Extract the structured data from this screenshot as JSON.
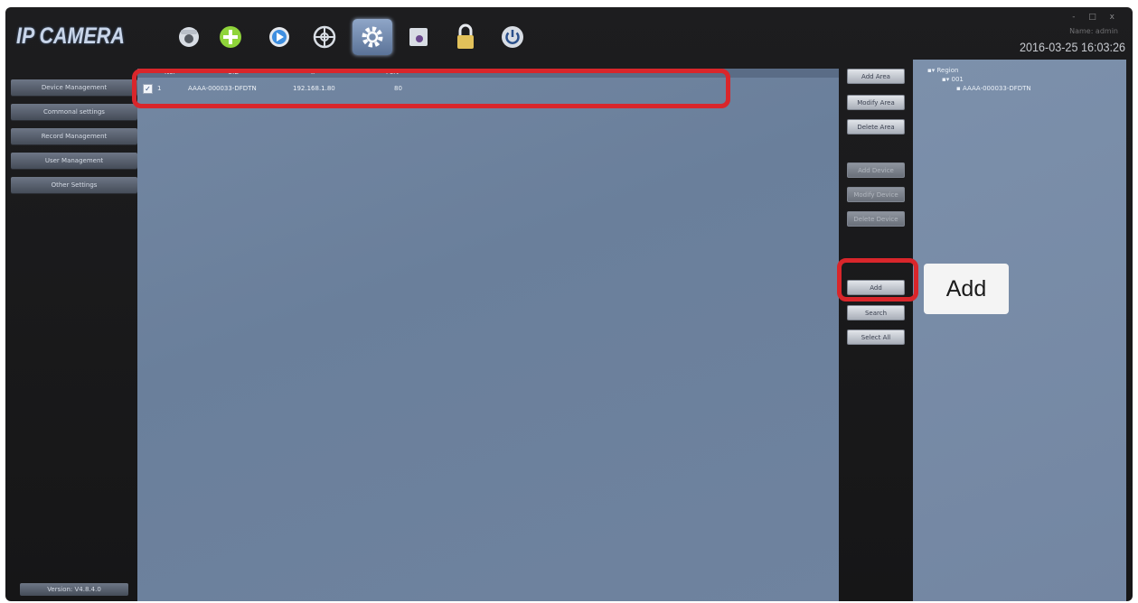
{
  "app": {
    "logo": "IP CAMERA"
  },
  "toolbar": {
    "items": [
      {
        "icon": "camera-dome-icon",
        "color": "#d8dde4"
      },
      {
        "icon": "add-circle-icon",
        "color": "#8fd43a"
      },
      {
        "icon": "play-icon",
        "color": "#3f8fe0"
      },
      {
        "icon": "ptz-icon",
        "color": "#d8dde4"
      },
      {
        "icon": "settings-gear-icon",
        "color": "#ffffff",
        "active": true
      },
      {
        "icon": "record-icon",
        "color": "#d8dde4"
      },
      {
        "icon": "lock-icon",
        "color": "#e2c15a"
      },
      {
        "icon": "power-icon",
        "color": "#d8dde4"
      }
    ]
  },
  "header": {
    "window_controls": "- □ x",
    "user": "Name: admin",
    "datetime": "2016-03-25 16:03:26"
  },
  "sidebar": {
    "items": [
      {
        "label": "Device Management"
      },
      {
        "label": "Commonal settings"
      },
      {
        "label": "Record Management"
      },
      {
        "label": "User Management"
      },
      {
        "label": "Other Settings"
      }
    ],
    "version": "Version: V4.8.4.0"
  },
  "device_table": {
    "columns": [
      "No.",
      "UID",
      "IP",
      "Port"
    ],
    "rows": [
      {
        "checked": true,
        "no": "1",
        "uid": "AAAA-000033-DFDTN",
        "ip": "192.168.1.80",
        "port": "80"
      }
    ]
  },
  "actions": {
    "add_area": "Add Area",
    "modify_area": "Modify Area",
    "delete_area": "Delete Area",
    "add_device": "Add Device",
    "modify_device": "Modify Device",
    "delete_device": "Delete Device",
    "add": "Add",
    "search": "Search",
    "select_all": "Select All"
  },
  "tree": {
    "root": "Region",
    "area": "001",
    "device": "AAAA-000033-DFDTN"
  },
  "annotation": {
    "callout": "Add",
    "color": "#d9262b"
  }
}
